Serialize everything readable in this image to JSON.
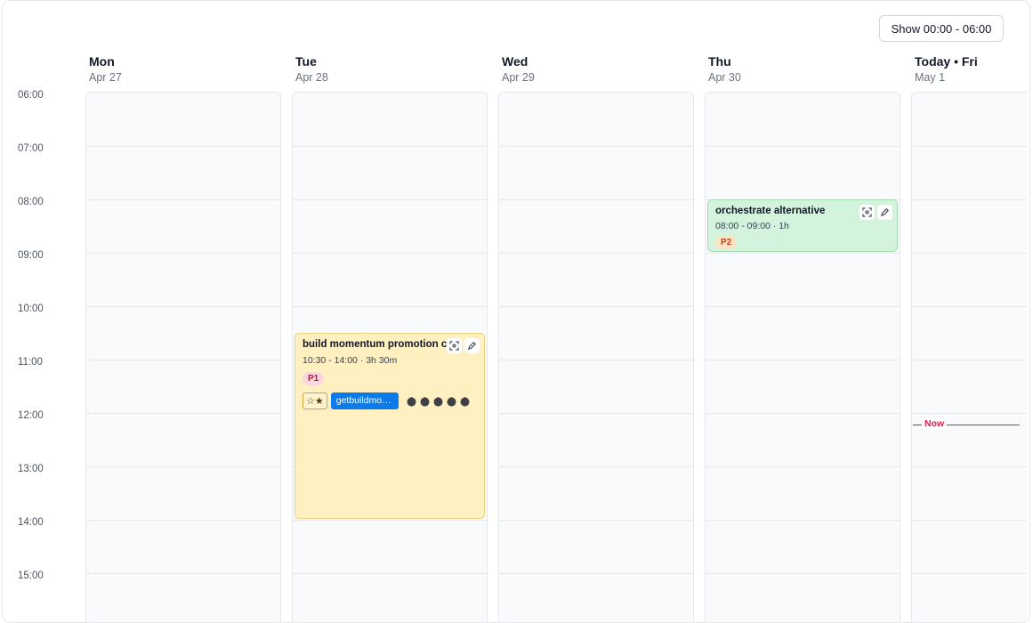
{
  "toolbar": {
    "show_range_label": "Show 00:00 - 06:00"
  },
  "days": [
    {
      "name": "Mon",
      "date": "Apr 27"
    },
    {
      "name": "Tue",
      "date": "Apr 28"
    },
    {
      "name": "Wed",
      "date": "Apr 29"
    },
    {
      "name": "Thu",
      "date": "Apr 30"
    },
    {
      "name": "Today • Fri",
      "date": "May 1"
    }
  ],
  "times": [
    "06:00",
    "07:00",
    "08:00",
    "09:00",
    "10:00",
    "11:00",
    "12:00",
    "13:00",
    "14:00",
    "15:00"
  ],
  "events": {
    "tue": {
      "title": "build momentum promotion c",
      "time": "10:30 - 14:00 · 3h 30m",
      "priority": "P1",
      "stars": "☆★",
      "link": "getbuildmo…",
      "tomato_icon": "tomato-icon",
      "tomato_count": 5
    },
    "thu": {
      "title": "orchestrate alternative",
      "time": "08:00 - 09:00 · 1h",
      "priority": "P2"
    }
  },
  "now_label": "Now",
  "colors": {
    "event_yellow": "#fef0c0",
    "event_green": "#d3f3dc",
    "now": "#e11d48",
    "link_chip": "#0b7bea"
  }
}
